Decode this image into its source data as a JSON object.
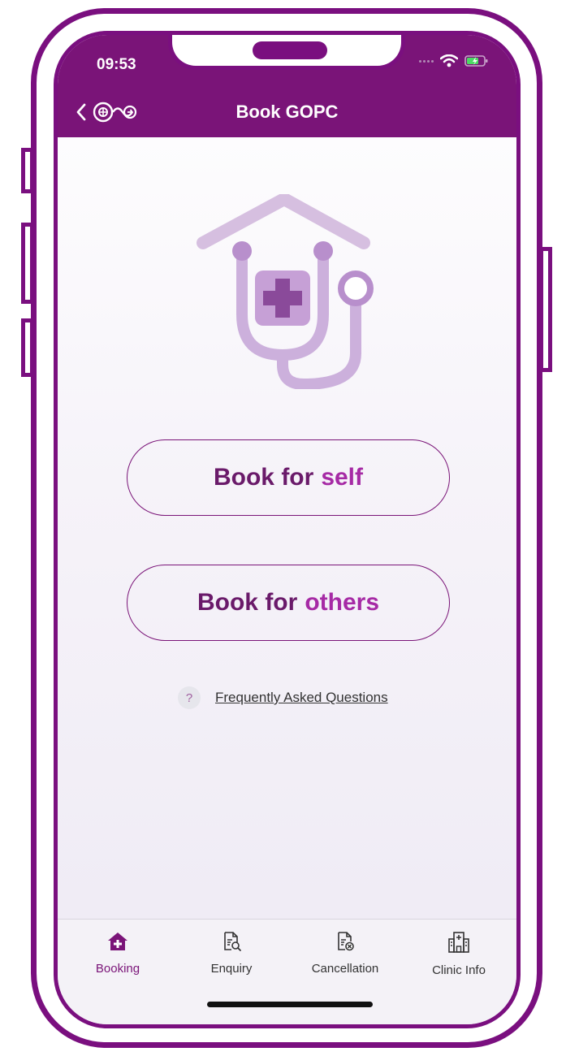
{
  "status_bar": {
    "time": "09:53"
  },
  "header": {
    "title": "Book GOPC"
  },
  "buttons": {
    "self": {
      "prefix": "Book for",
      "accent": "self"
    },
    "others": {
      "prefix": "Book for",
      "accent": "others"
    }
  },
  "faq": {
    "icon_text": "?",
    "label": "Frequently Asked Questions"
  },
  "tabs": [
    {
      "label": "Booking",
      "icon": "home-plus-icon",
      "active": true
    },
    {
      "label": "Enquiry",
      "icon": "document-search-icon",
      "active": false
    },
    {
      "label": "Cancellation",
      "icon": "document-cancel-icon",
      "active": false
    },
    {
      "label": "Clinic Info",
      "icon": "hospital-icon",
      "active": false
    }
  ],
  "colors": {
    "brand": "#7a1478",
    "accent": "#a62aa5",
    "frame": "#7a0f7f",
    "icon_light": "#d6bfe0",
    "icon_mid": "#b88fcc",
    "icon_dark": "#8a4a9a"
  }
}
